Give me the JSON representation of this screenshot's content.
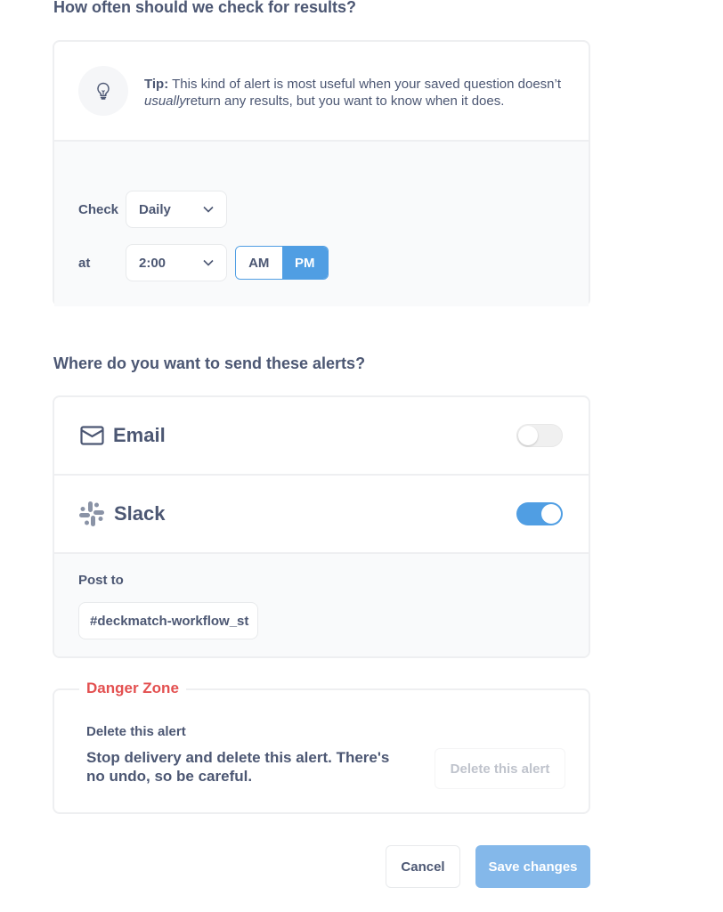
{
  "frequency_section": {
    "title": "How often should we check for results?",
    "tip_label": "Tip:",
    "tip_text_1": "This kind of alert is most useful when your saved question doesn’t",
    "tip_emphasis": "usually",
    "tip_text_2": "return any results, but you want to know when it does.",
    "tip_icon": "lightbulb-icon",
    "check_label": "Check",
    "frequency_value": "Daily",
    "at_label": "at",
    "time_value": "2:00",
    "am_label": "AM",
    "pm_label": "PM",
    "selected_period": "PM"
  },
  "destination_section": {
    "title": "Where do you want to send these alerts?",
    "email": {
      "label": "Email",
      "icon": "mail-icon",
      "enabled": false
    },
    "slack": {
      "label": "Slack",
      "icon": "slack-icon",
      "enabled": true
    },
    "post_to_label": "Post to",
    "channel_value": "#deckmatch-workflow_st"
  },
  "danger_zone": {
    "title": "Danger Zone",
    "heading": "Delete this alert",
    "description": "Stop delivery and delete this alert. There's no undo, so be careful.",
    "delete_button": "Delete this alert"
  },
  "footer": {
    "cancel_label": "Cancel",
    "save_label": "Save changes"
  },
  "colors": {
    "brand": "#509ee3",
    "danger": "#e35050",
    "text": "#4c5773"
  }
}
